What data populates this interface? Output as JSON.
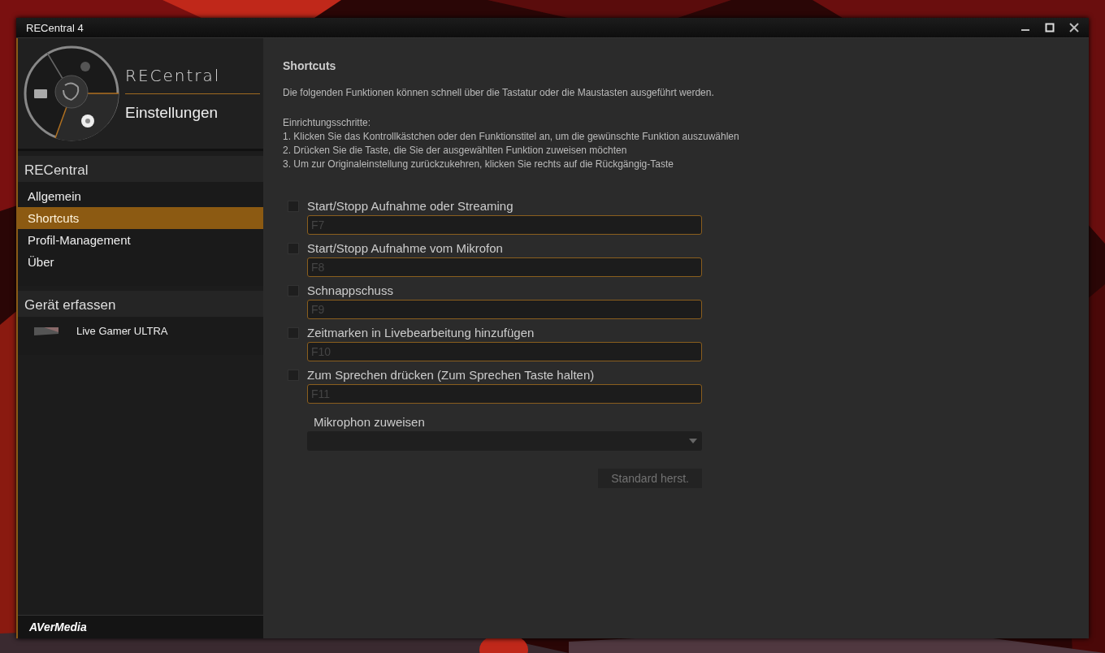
{
  "window": {
    "title": "RECentral 4"
  },
  "header": {
    "logo": "RECentral",
    "title": "Einstellungen"
  },
  "sidebar": {
    "sections": [
      {
        "heading": "RECentral",
        "items": [
          {
            "label": "Allgemein",
            "selected": false
          },
          {
            "label": "Shortcuts",
            "selected": true
          },
          {
            "label": "Profil-Management",
            "selected": false
          },
          {
            "label": "Über",
            "selected": false
          }
        ]
      },
      {
        "heading": "Gerät erfassen",
        "items": [
          {
            "label": "Live Gamer ULTRA",
            "selected": false,
            "kind": "device"
          }
        ]
      }
    ],
    "footer": "AVerMedia"
  },
  "content": {
    "title": "Shortcuts",
    "description": "Die folgenden Funktionen können schnell über die Tastatur oder die Maustasten ausgeführt werden.",
    "steps_heading": "Einrichtungsschritte:",
    "steps": [
      "1. Klicken Sie das Kontrollkästchen oder den Funktionstitel an, um die gewünschte Funktion auszuwählen",
      "2. Drücken Sie die Taste, die Sie der ausgewählten Funktion zuweisen möchten",
      "3. Um zur Originaleinstellung zurückzukehren, klicken Sie rechts auf die Rückgängig-Taste"
    ],
    "shortcuts": [
      {
        "label": "Start/Stopp Aufnahme oder Streaming",
        "checked": false,
        "key": "F7"
      },
      {
        "label": "Start/Stopp Aufnahme vom Mikrofon",
        "checked": false,
        "key": "F8"
      },
      {
        "label": "Schnappschuss",
        "checked": false,
        "key": "F9"
      },
      {
        "label": "Zeitmarken in Livebearbeitung hinzufügen",
        "checked": false,
        "key": "F10"
      },
      {
        "label": "Zum Sprechen drücken (Zum Sprechen Taste halten)",
        "checked": false,
        "key": "F11"
      }
    ],
    "microphone": {
      "label": "Mikrophon zuweisen"
    },
    "reset_button": {
      "label": "Standard herst.",
      "disabled": true
    }
  }
}
